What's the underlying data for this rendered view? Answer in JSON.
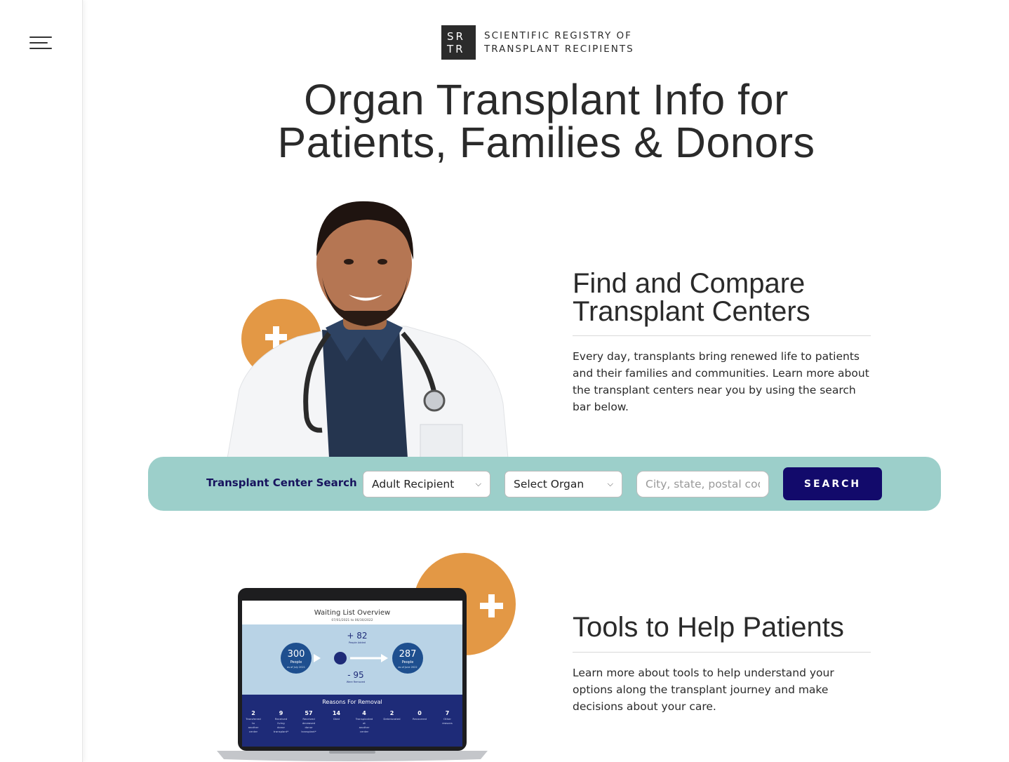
{
  "logo": {
    "mark_line1": "SR",
    "mark_line2": "TR",
    "name_line1": "SCIENTIFIC REGISTRY OF",
    "name_line2": "TRANSPLANT RECIPIENTS"
  },
  "hero": {
    "title_line1": "Organ Transplant Info for",
    "title_line2": "Patients, Families & Donors"
  },
  "find_section": {
    "heading_line1": "Find and Compare",
    "heading_line2": "Transplant Centers",
    "body": "Every day, transplants bring renewed life to patients and their families and communities. Learn more about the transplant centers near you by using the search bar below."
  },
  "search": {
    "label": "Transplant Center Search",
    "recipient_value": "Adult Recipient",
    "organ_value": "Select Organ",
    "location_placeholder": "City, state, postal code",
    "button_label": "SEARCH"
  },
  "tools_section": {
    "heading": "Tools to Help Patients",
    "body": "Learn more about tools to help understand your options along the transplant journey and make decisions about your care."
  },
  "laptop_screen": {
    "title": "Waiting List Overview",
    "date_range": "07/01/2021 to 06/30/2022",
    "start_count": "300",
    "start_label": "People",
    "start_sub": "as of July 2021",
    "added": "+ 82",
    "added_label": "People Added",
    "removed": "- 95",
    "removed_label": "Were Removed",
    "end_count": "287",
    "end_label": "People",
    "end_sub": "as of June 2022",
    "removal_title": "Reasons For Removal",
    "removal_items": [
      {
        "value": "2",
        "label": "Transferred to another center"
      },
      {
        "value": "9",
        "label": "Received living donor transplant*"
      },
      {
        "value": "57",
        "label": "Received deceased donor transplant*"
      },
      {
        "value": "14",
        "label": "Died"
      },
      {
        "value": "4",
        "label": "Transplanted at another center"
      },
      {
        "value": "2",
        "label": "Deteriorated"
      },
      {
        "value": "0",
        "label": "Recovered"
      },
      {
        "value": "7",
        "label": "Other reasons"
      }
    ]
  },
  "colors": {
    "accent_orange": "#e39845",
    "search_bar": "#9ccfca",
    "button_navy": "#120a6b",
    "screen_blue": "#b9d3e6",
    "screen_navy": "#1e2b78"
  }
}
